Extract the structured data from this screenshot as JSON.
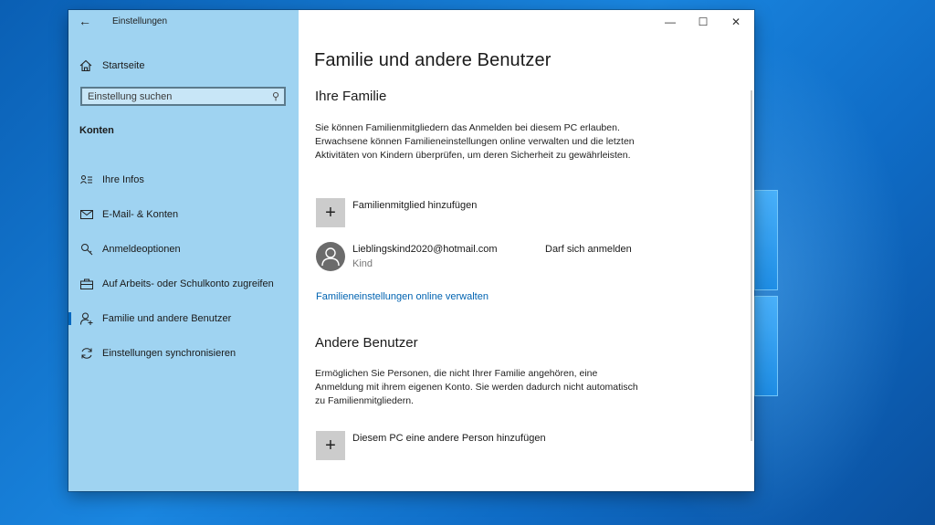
{
  "window": {
    "app_title": "Einstellungen",
    "controls": {
      "minimize": "—",
      "maximize": "☐",
      "close": "✕"
    }
  },
  "sidebar": {
    "home_label": "Startseite",
    "search_placeholder": "Einstellung suchen",
    "section_title": "Konten",
    "items": [
      {
        "label": "Ihre Infos",
        "icon": "person-card-icon"
      },
      {
        "label": "E-Mail- & Konten",
        "icon": "mail-icon"
      },
      {
        "label": "Anmeldeoptionen",
        "icon": "key-icon"
      },
      {
        "label": "Auf Arbeits- oder Schulkonto zugreifen",
        "icon": "briefcase-icon"
      },
      {
        "label": "Familie und andere Benutzer",
        "icon": "person-add-icon",
        "active": true
      },
      {
        "label": "Einstellungen synchronisieren",
        "icon": "sync-icon"
      }
    ]
  },
  "main": {
    "title": "Familie und andere Benutzer",
    "family": {
      "heading": "Ihre Familie",
      "description": "Sie können Familienmitgliedern das Anmelden bei diesem PC erlauben. Erwachsene können Familieneinstellungen online verwalten und die letzten Aktivitäten von Kindern überprüfen, um deren Sicherheit zu gewährleisten.",
      "add_label": "Familienmitglied hinzufügen",
      "member": {
        "email": "Lieblingskind2020@hotmail.com",
        "role": "Kind",
        "permission": "Darf sich anmelden"
      },
      "manage_link": "Familieneinstellungen online verwalten"
    },
    "others": {
      "heading": "Andere Benutzer",
      "description": "Ermöglichen Sie Personen, die nicht Ihrer Familie angehören, eine Anmeldung mit ihrem eigenen Konto. Sie werden dadurch nicht automatisch zu Familienmitgliedern.",
      "add_label": "Diesem PC eine andere Person hinzufügen"
    }
  },
  "colors": {
    "sidebar": "#9fd3f1",
    "accent": "#0063b1",
    "plus_tile": "#cccccc"
  }
}
